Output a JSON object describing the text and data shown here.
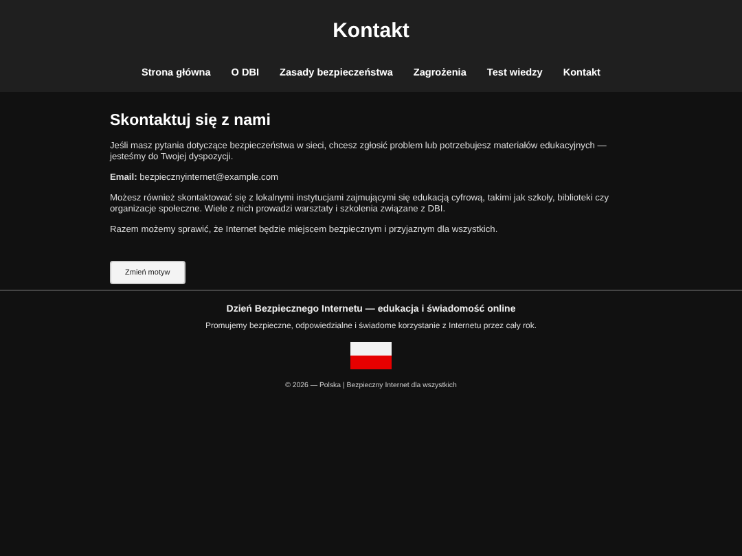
{
  "header": {
    "title": "Kontakt"
  },
  "nav": [
    "Strona główna",
    "O DBI",
    "Zasady bezpieczeństwa",
    "Zagrożenia",
    "Test wiedzy",
    "Kontakt"
  ],
  "main": {
    "heading": "Skontaktuj się z nami",
    "paragraphs": [
      "Jeśli masz pytania dotyczące bezpieczeństwa w sieci, chcesz zgłosić problem lub potrzebujesz materiałów edukacyjnych — jesteśmy do Twojej dyspozycji.",
      "**Email:** bezpiecznyinternet@example.com",
      "Możesz również skontaktować się z lokalnymi instytucjami zajmującymi się edukacją cyfrową, takimi jak szkoły, biblioteki czy organizacje społeczne. Wiele z nich prowadzi warsztaty i szkolenia związane z DBI.",
      "Razem możemy sprawić, że Internet będzie miejscem bezpiecznym i przyjaznym dla wszystkich."
    ],
    "button": "Zmień motyw"
  },
  "footer": {
    "title": "Dzień Bezpiecznego Internetu — edukacja i świadomość online",
    "subtitle": "Promujemy bezpieczne, odpowiedzialne i świadome korzystanie z Internetu przez cały rok.",
    "copyright": "© 2026 — Polska | Bezpieczny Internet dla wszystkich"
  }
}
